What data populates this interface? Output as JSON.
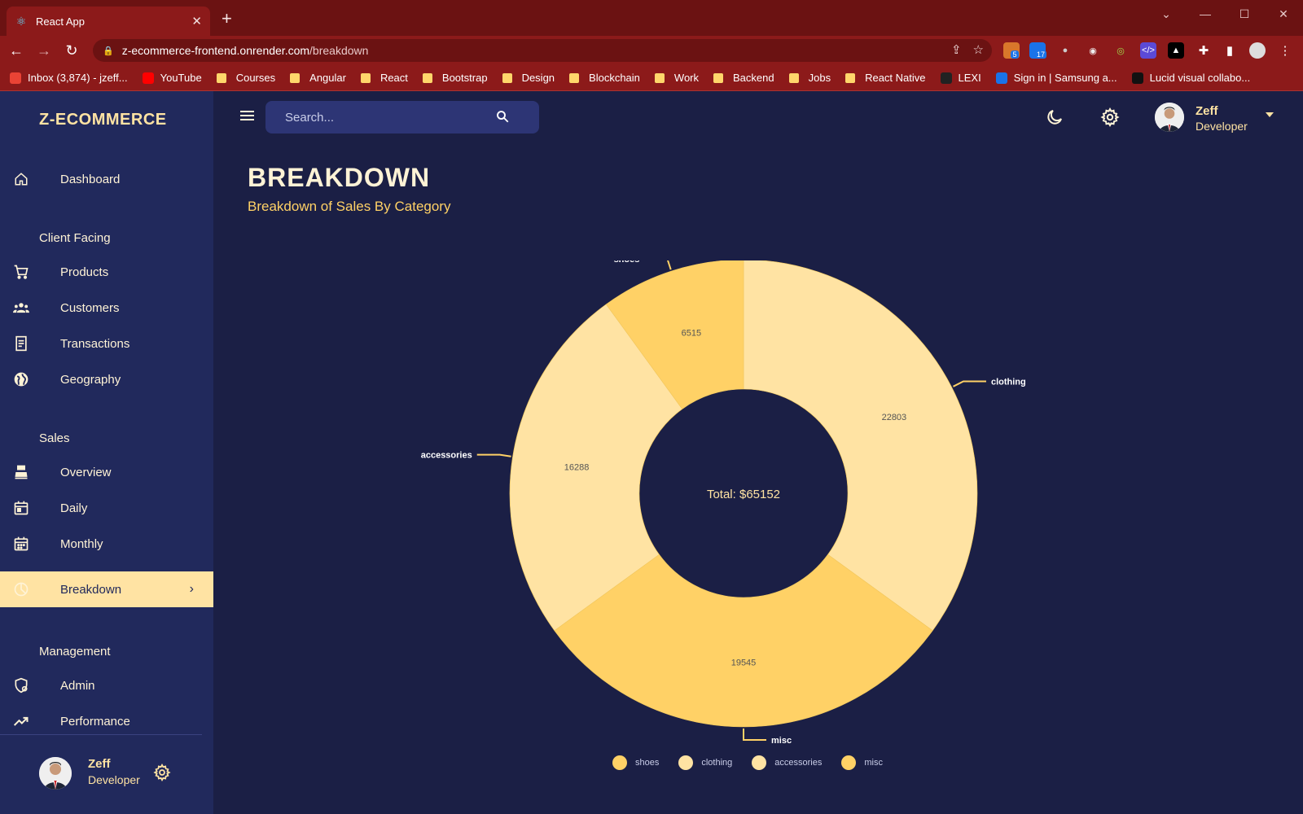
{
  "browser": {
    "tab_title": "React App",
    "url_host": "z-ecommerce-frontend.onrender.com",
    "url_path": "/breakdown",
    "extension_badges": [
      "5",
      "17"
    ],
    "bookmarks": [
      {
        "label": "Inbox (3,874) - jzeff...",
        "icon": "gmail-icon"
      },
      {
        "label": "YouTube",
        "icon": "youtube-icon"
      },
      {
        "label": "Courses",
        "icon": "folder-icon"
      },
      {
        "label": "Angular",
        "icon": "folder-icon"
      },
      {
        "label": "React",
        "icon": "folder-icon"
      },
      {
        "label": "Bootstrap",
        "icon": "folder-icon"
      },
      {
        "label": "Design",
        "icon": "folder-icon"
      },
      {
        "label": "Blockchain",
        "icon": "folder-icon"
      },
      {
        "label": "Work",
        "icon": "folder-icon"
      },
      {
        "label": "Backend",
        "icon": "folder-icon"
      },
      {
        "label": "Jobs",
        "icon": "folder-icon"
      },
      {
        "label": "React Native",
        "icon": "folder-icon"
      },
      {
        "label": "LEXI",
        "icon": "react-icon"
      },
      {
        "label": "Sign in | Samsung a...",
        "icon": "samsung-icon"
      },
      {
        "label": "Lucid visual collabo...",
        "icon": "lucid-icon"
      }
    ]
  },
  "app": {
    "brand": "Z-ECOMMERCE",
    "search_placeholder": "Search...",
    "user": {
      "name": "Zeff",
      "role": "Developer"
    },
    "nav": {
      "dashboard": "Dashboard",
      "section_client": "Client Facing",
      "products": "Products",
      "customers": "Customers",
      "transactions": "Transactions",
      "geography": "Geography",
      "section_sales": "Sales",
      "overview": "Overview",
      "daily": "Daily",
      "monthly": "Monthly",
      "breakdown": "Breakdown",
      "section_management": "Management",
      "admin": "Admin",
      "performance": "Performance"
    },
    "active_nav": "breakdown"
  },
  "page": {
    "title": "BREAKDOWN",
    "subtitle": "Breakdown of Sales By Category"
  },
  "chart_data": {
    "type": "pie",
    "donut": true,
    "center_label": "Total: $65152",
    "slices": [
      {
        "label": "clothing",
        "value": 22803,
        "color": "#ffe3a3"
      },
      {
        "label": "misc",
        "value": 19545,
        "color": "#ffd166"
      },
      {
        "label": "accessories",
        "value": 16288,
        "color": "#ffe3a3"
      },
      {
        "label": "shoes",
        "value": 6515,
        "color": "#ffd166"
      }
    ],
    "legend": [
      {
        "label": "shoes",
        "color": "#ffd166"
      },
      {
        "label": "clothing",
        "color": "#ffe3a3"
      },
      {
        "label": "accessories",
        "color": "#ffe3a3"
      },
      {
        "label": "misc",
        "color": "#ffd166"
      }
    ],
    "legend_position": "bottom"
  },
  "colors": {
    "background": "#1b1f45",
    "sidebar": "#21295c",
    "accent": "#ffe3a3",
    "accent_strong": "#ffd166",
    "browser_chrome": "#8c1a1a"
  }
}
